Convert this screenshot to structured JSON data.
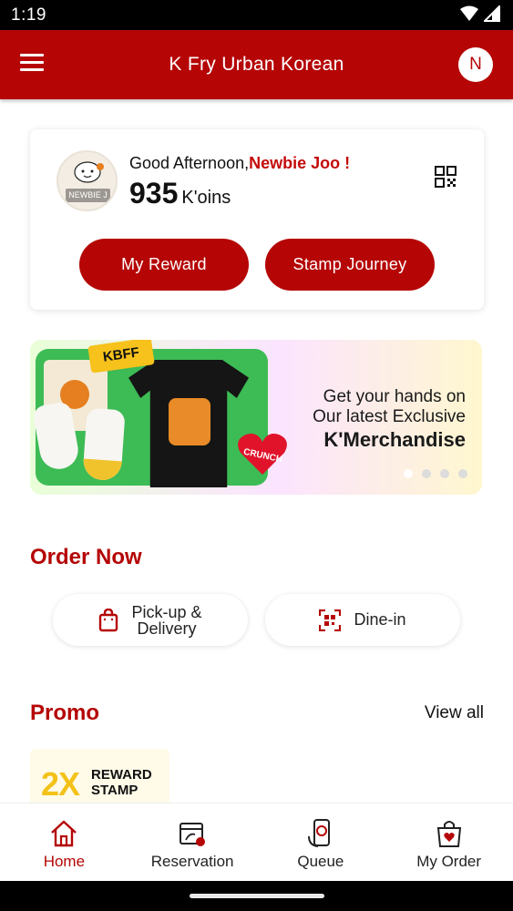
{
  "status_bar": {
    "time": "1:19",
    "icons": [
      "wifi-icon",
      "signal-icon"
    ]
  },
  "app_bar": {
    "title": "K Fry Urban Korean",
    "avatar_initial": "N",
    "menu_icon": "hamburger-menu-icon"
  },
  "profile_card": {
    "avatar_tag": "NEWBIE J",
    "greeting": "Good Afternoon,",
    "name": "Newbie Joo !",
    "points": "935",
    "points_unit": "K'oins",
    "my_reward_label": "My Reward",
    "stamp_journey_label": "Stamp Journey",
    "qr_icon": "qr-code-icon"
  },
  "banner": {
    "tag": "KBFF",
    "line1": "Get your hands on",
    "line2": "Our latest Exclusive",
    "line3": "K'Merchandise",
    "heart_text": "CRUNCH",
    "slide_count": 4,
    "active_slide": 0
  },
  "order_now": {
    "title": "Order Now",
    "pickup_line1": "Pick-up &",
    "pickup_line2": "Delivery",
    "dinein_label": "Dine-in"
  },
  "promo": {
    "title": "Promo",
    "view_all": "View all",
    "card": {
      "big_text": "2X",
      "line1": "REWARD",
      "line2": "STAMP"
    }
  },
  "bottom_nav": {
    "items": [
      {
        "label": "Home",
        "icon": "home-icon",
        "active": true
      },
      {
        "label": "Reservation",
        "icon": "reservation-icon",
        "active": false
      },
      {
        "label": "Queue",
        "icon": "queue-icon",
        "active": false
      },
      {
        "label": "My Order",
        "icon": "my-order-icon",
        "active": false
      }
    ]
  },
  "colors": {
    "brand_red": "#b50505",
    "name_red": "#c30a0a",
    "banner_green": "#3dbb55",
    "promo_yellow": "#f3c21a"
  }
}
